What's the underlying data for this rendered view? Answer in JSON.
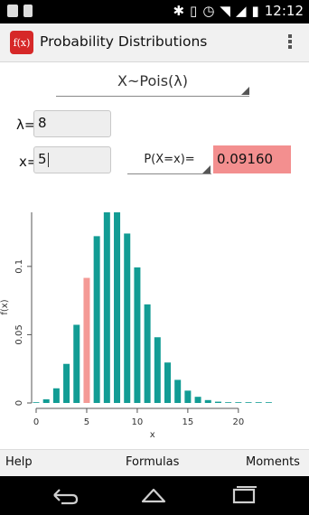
{
  "status": {
    "time": "12:12"
  },
  "app": {
    "title": "Probability Distributions",
    "icon_text": "f(x)"
  },
  "distribution": {
    "selected": "X~Pois(λ)"
  },
  "params": {
    "lambda_label": "λ=",
    "lambda_value": "8",
    "x_label": "x=",
    "x_value": "5"
  },
  "probability": {
    "selected": "P(X=x)=",
    "result": "0.09160"
  },
  "chart_data": {
    "type": "bar",
    "xlabel": "x",
    "ylabel": "f(x)",
    "x_ticks": [
      "0",
      "5",
      "10",
      "15",
      "20"
    ],
    "y_ticks": [
      "0",
      "0.05",
      "0.1"
    ],
    "xlim": [
      0,
      23.5
    ],
    "ylim": [
      0,
      0.1396
    ],
    "highlight_x": 5,
    "x": [
      0,
      1,
      2,
      3,
      4,
      5,
      6,
      7,
      8,
      9,
      10,
      11,
      12,
      13,
      14,
      15,
      16,
      17,
      18,
      19,
      20,
      21,
      22,
      23
    ],
    "values": [
      0.000335,
      0.00268,
      0.01073,
      0.02863,
      0.05725,
      0.0916,
      0.12214,
      0.13959,
      0.13959,
      0.12408,
      0.09926,
      0.07219,
      0.04813,
      0.02962,
      0.01692,
      0.00903,
      0.00451,
      0.00212,
      0.00094,
      0.0004,
      0.00016,
      6e-05,
      2e-05,
      1e-05
    ],
    "bar_color": "#129c94",
    "highlight_color": "#f49a96"
  },
  "bottom_bar": {
    "help": "Help",
    "formulas": "Formulas",
    "moments": "Moments"
  }
}
